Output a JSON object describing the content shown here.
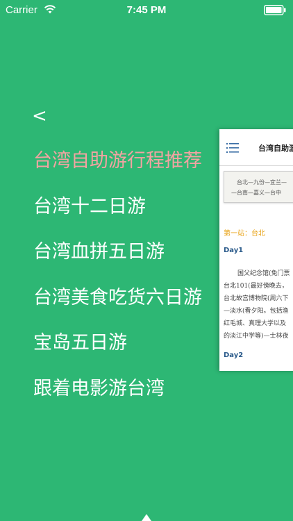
{
  "status_bar": {
    "carrier": "Carrier",
    "time": "7:45 PM",
    "wifi_icon": "wifi-icon",
    "battery_icon": "battery-icon"
  },
  "menu": {
    "back_label": "<",
    "items": [
      {
        "label": "台湾自助游行程推荐",
        "active": true
      },
      {
        "label": "台湾十二日游",
        "active": false
      },
      {
        "label": "台湾血拼五日游",
        "active": false
      },
      {
        "label": "台湾美食吃货六日游",
        "active": false
      },
      {
        "label": "宝岛五日游",
        "active": false
      },
      {
        "label": "跟着电影游台湾",
        "active": false
      }
    ],
    "active_color": "#f2a4a2"
  },
  "preview": {
    "title": "台湾自助游",
    "route_line_1": "台北—九份—宜兰—",
    "route_line_2": "—台南—嘉义—台中",
    "station_heading": "第一站：台北",
    "day1": "Day1",
    "day1_lines": [
      "国父纪念馆(免门票",
      "台北101(最好傍晚去，",
      "台北故宫博物院(周六下",
      "—淡水(看夕阳。包括渔",
      "红毛城、真理大学以及",
      "的淡江中学等)—士林夜"
    ],
    "day2": "Day2",
    "menu_icon": "hamburger-icon"
  },
  "colors": {
    "background": "#2db774",
    "station_heading": "#e8a317",
    "day_heading": "#2a5a8a"
  }
}
